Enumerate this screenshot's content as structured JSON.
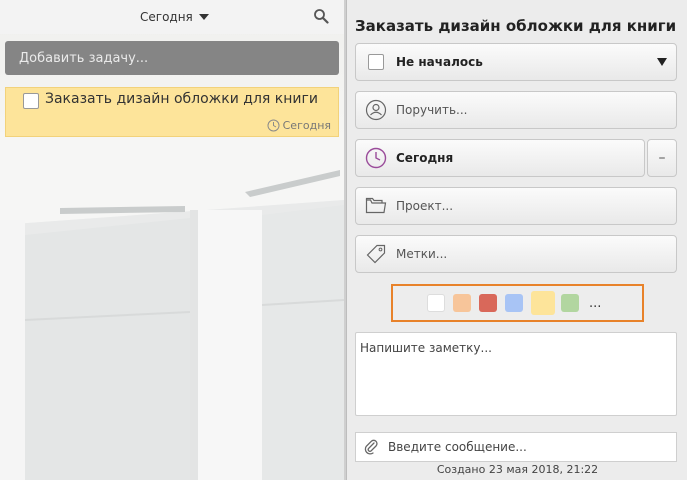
{
  "list": {
    "date_filter": "Сегодня",
    "add_task_placeholder": "Добавить задачу...",
    "tasks": [
      {
        "title": "Заказать дизайн обложки для книги",
        "due": "Сегодня",
        "color": "#fde49a"
      }
    ]
  },
  "detail": {
    "title": "Заказать дизайн обложки для книги",
    "status": "Не началось",
    "assign_placeholder": "Поручить...",
    "due": "Сегодня",
    "project_placeholder": "Проект...",
    "tags_placeholder": "Метки...",
    "colors": [
      "#ffffff",
      "#f7c59a",
      "#d9685a",
      "#a8c4f5",
      "#fde49a",
      "#b2d6a0"
    ],
    "selected_color": "#fde49a",
    "more_colors": "...",
    "note_placeholder": "Напишите заметку...",
    "message_placeholder": "Введите сообщение...",
    "created": "Создано 23 мая 2018, 21:22"
  },
  "icons": {
    "search": "search-icon",
    "clock": "clock-icon",
    "person": "person-icon",
    "folder": "folder-icon",
    "tag": "tag-icon",
    "attach": "paperclip-icon"
  }
}
